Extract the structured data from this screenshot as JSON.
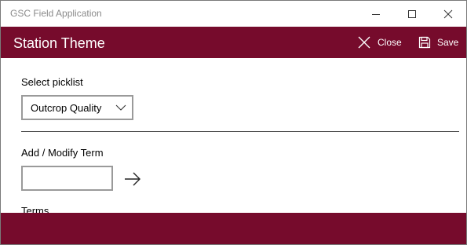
{
  "window": {
    "title": "GSC Field Application"
  },
  "appbar": {
    "page_title": "Station Theme",
    "close_label": "Close",
    "save_label": "Save",
    "close_icon": "close-icon",
    "save_icon": "save-icon"
  },
  "form": {
    "picklist_label": "Select picklist",
    "picklist_selected": "Outcrop Quality",
    "term_label": "Add / Modify Term",
    "term_value": "",
    "term_placeholder": "",
    "terms_label": "Terms"
  },
  "colors": {
    "accent": "#760b2c",
    "field_border": "#9a9a9a",
    "title_text": "#8a8a8a"
  }
}
